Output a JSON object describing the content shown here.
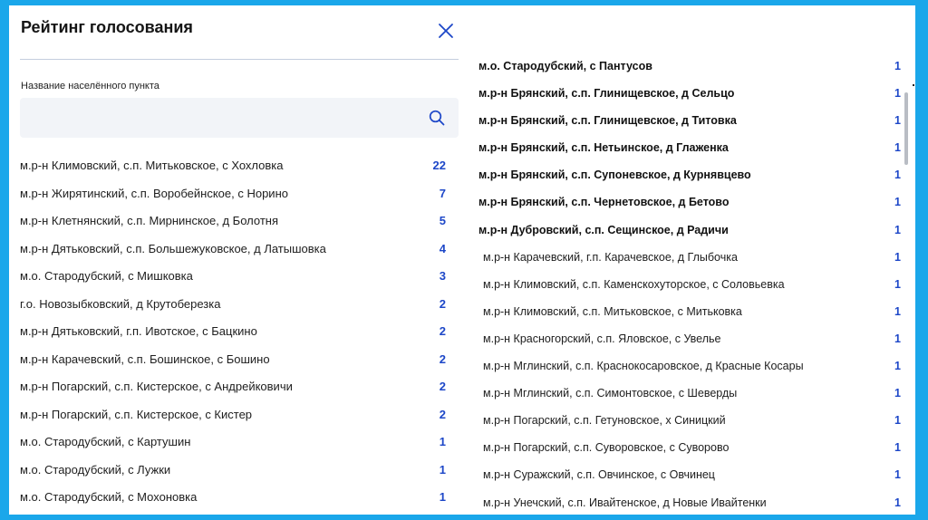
{
  "window": {
    "title": "Рейтинг голосования",
    "close_icon": "close-icon",
    "accent_color": "#1d47c8",
    "background_color": "#1aa7ea"
  },
  "search": {
    "label": "Название населённого пункта",
    "value": "",
    "placeholder": "",
    "icon": "search-icon"
  },
  "left_list": [
    {
      "name": "м.р-н Климовский, с.п. Митьковское, с Хохловка",
      "count": "22"
    },
    {
      "name": "м.р-н Жирятинский, с.п. Воробейнское, с Норино",
      "count": "7"
    },
    {
      "name": "м.р-н Клетнянский, с.п. Мирнинское, д Болотня",
      "count": "5"
    },
    {
      "name": "м.р-н Дятьковский, с.п. Большежуковское, д Латышовка",
      "count": "4"
    },
    {
      "name": "м.о. Стародубский, с Мишковка",
      "count": "3"
    },
    {
      "name": "г.о. Новозыбковский, д Крутоберезка",
      "count": "2"
    },
    {
      "name": "м.р-н Дятьковский, г.п. Ивотское, с Бацкино",
      "count": "2"
    },
    {
      "name": "м.р-н Карачевский, с.п. Бошинское, с Бошино",
      "count": "2"
    },
    {
      "name": "м.р-н Погарский, с.п. Кистерское, с Андрейковичи",
      "count": "2"
    },
    {
      "name": "м.р-н Погарский, с.п. Кистерское, с Кистер",
      "count": "2"
    },
    {
      "name": "м.о. Стародубский, с Картушин",
      "count": "1"
    },
    {
      "name": "м.о. Стародубский, с Лужки",
      "count": "1"
    },
    {
      "name": "м.о. Стародубский, с Мохоновка",
      "count": "1"
    }
  ],
  "right_list": [
    {
      "name": "м.о. Стародубский, с Пантусов",
      "count": "1",
      "bold": true
    },
    {
      "name": "м.р-н Брянский, с.п. Глинищевское, д Сельцо",
      "count": "1",
      "bold": true
    },
    {
      "name": "м.р-н Брянский, с.п. Глинищевское, д Титовка",
      "count": "1",
      "bold": true
    },
    {
      "name": "м.р-н Брянский, с.п. Нетьинское, д Глаженка",
      "count": "1",
      "bold": true
    },
    {
      "name": "м.р-н Брянский, с.п. Супоневское, д Курнявцево",
      "count": "1",
      "bold": true
    },
    {
      "name": "м.р-н Брянский, с.п. Чернетовское, д Бетово",
      "count": "1",
      "bold": true
    },
    {
      "name": "м.р-н Дубровский, с.п. Сещинское, д Радичи",
      "count": "1",
      "bold": true
    },
    {
      "name": "м.р-н Карачевский, г.п. Карачевское, д Глыбочка",
      "count": "1",
      "bold": false
    },
    {
      "name": "м.р-н Климовский, с.п. Каменскохуторское, с Соловьевка",
      "count": "1",
      "bold": false
    },
    {
      "name": "м.р-н Климовский, с.п. Митьковское, с Митьковка",
      "count": "1",
      "bold": false
    },
    {
      "name": "м.р-н Красногорский, с.п. Яловское, с Увелье",
      "count": "1",
      "bold": false
    },
    {
      "name": "м.р-н Мглинский, с.п. Краснокосаровское, д Красные Косары",
      "count": "1",
      "bold": false
    },
    {
      "name": "м.р-н Мглинский, с.п. Симонтовское, с Шеверды",
      "count": "1",
      "bold": false
    },
    {
      "name": "м.р-н Погарский, с.п. Гетуновское, х Синицкий",
      "count": "1",
      "bold": false
    },
    {
      "name": "м.р-н Погарский, с.п. Суворовское, с Суворово",
      "count": "1",
      "bold": false
    },
    {
      "name": "м.р-н Суражский, с.п. Овчинское, с Овчинец",
      "count": "1",
      "bold": false
    },
    {
      "name": "м.р-н Унечский, с.п. Ивайтенское, д Новые Ивайтенки",
      "count": "1",
      "bold": false
    }
  ]
}
